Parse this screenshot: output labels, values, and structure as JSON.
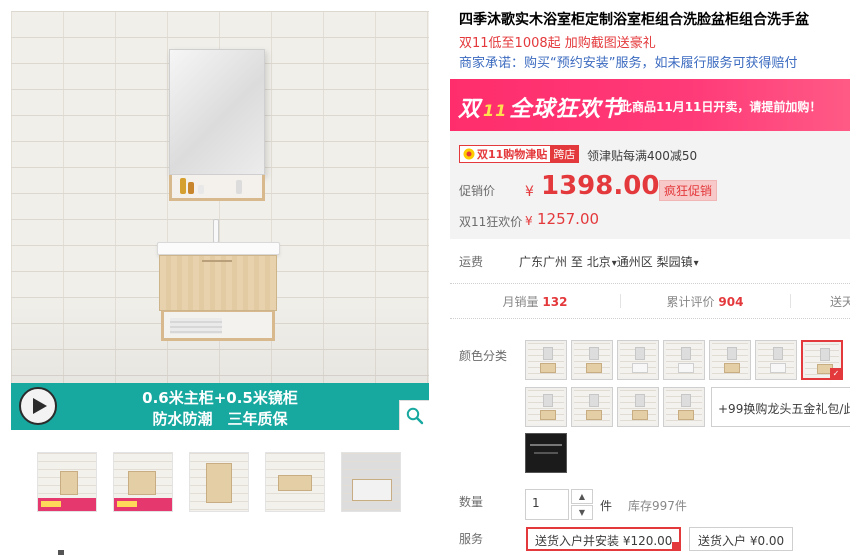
{
  "product": {
    "title": "四季沐歌实木浴室柜定制浴室柜组合洗脸盆柜组合洗手盆",
    "subtitle": "双11低至1008起 加购截图送豪礼",
    "promise": "商家承诺：购买“预约安装”服务，如未履行服务可获得赔付"
  },
  "gallery": {
    "banner_line1": "0.6米主柜+0.5米镜柜",
    "banner_line2": "防水防潮　三年质保",
    "play_icon": "play-icon",
    "zoom_icon": "search-icon",
    "thumb_count": 5
  },
  "promo": {
    "logo_left": "双",
    "logo_mid": "11",
    "logo_right": "全球狂欢节",
    "text": "此商品11月11日开卖，请提前加购！"
  },
  "price": {
    "tag_a": "双11购物津贴",
    "tag_b": "跨店",
    "coupon": "领津贴每满400减50",
    "label": "促销价",
    "yen": "¥",
    "value": "1398.00",
    "badge": "疯狂促销",
    "d11_label": "双11狂欢价",
    "d11_yen": "¥",
    "d11_value": "1257.00"
  },
  "shipping": {
    "label": "运费",
    "from": "广东广州",
    "to_word": "至",
    "city": "北京",
    "district": "通州区",
    "town": "梨园镇"
  },
  "stats": {
    "sales_label": "月销量",
    "sales_value": "132",
    "reviews_label": "累计评价",
    "reviews_value": "904",
    "points_label": "送天"
  },
  "options": {
    "color_label": "颜色分类",
    "extra_option": "+99换购龙头五金礼包/此",
    "selected_index": 6
  },
  "quantity": {
    "label": "数量",
    "value": "1",
    "unit": "件",
    "stock": "库存997件"
  },
  "service": {
    "label": "服务",
    "opt1": "送货入户并安装 ¥120.00",
    "opt2": "送货入户 ¥0.00"
  },
  "colors": {
    "accent": "#e4393c",
    "promo": "#ff2d6c",
    "banner": "#17a8a0",
    "link": "#3c6bc0"
  }
}
